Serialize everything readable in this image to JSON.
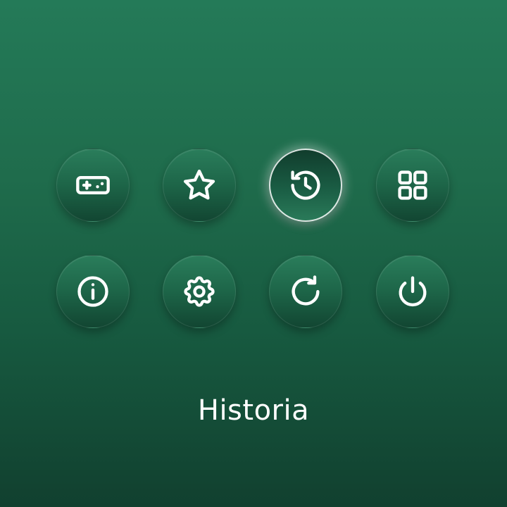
{
  "menu": {
    "buttons": [
      {
        "id": "games",
        "icon": "gamepad-icon"
      },
      {
        "id": "favorites",
        "icon": "star-icon"
      },
      {
        "id": "history",
        "icon": "history-icon",
        "selected": true
      },
      {
        "id": "apps",
        "icon": "grid-icon"
      },
      {
        "id": "info",
        "icon": "info-icon"
      },
      {
        "id": "settings",
        "icon": "gear-icon"
      },
      {
        "id": "refresh",
        "icon": "refresh-icon"
      },
      {
        "id": "power",
        "icon": "power-icon"
      }
    ]
  },
  "caption": {
    "label": "Historia"
  },
  "colors": {
    "background_top": "#247a58",
    "background_bottom": "#11402f",
    "icon": "#ffffff",
    "selected_ring": "#ffffff"
  }
}
